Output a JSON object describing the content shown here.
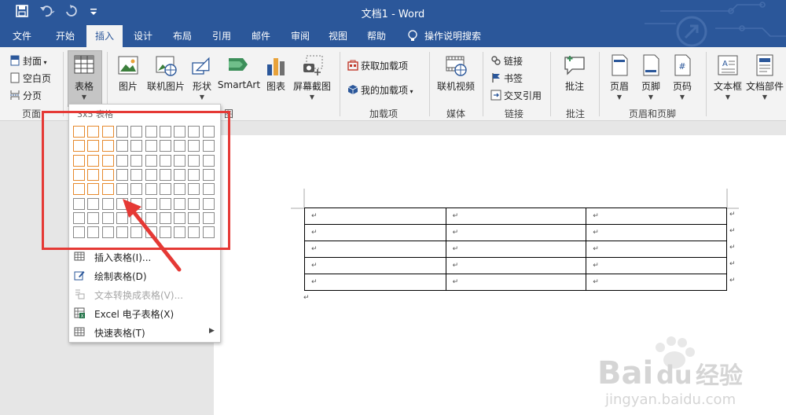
{
  "titlebar": {
    "title": "文档1 - Word",
    "icons": [
      "save-icon",
      "undo-icon",
      "redo-icon",
      "customize-icon"
    ]
  },
  "tabs": [
    {
      "label": "文件"
    },
    {
      "label": "开始"
    },
    {
      "label": "插入",
      "active": true
    },
    {
      "label": "设计"
    },
    {
      "label": "布局"
    },
    {
      "label": "引用"
    },
    {
      "label": "邮件"
    },
    {
      "label": "审阅"
    },
    {
      "label": "视图"
    },
    {
      "label": "帮助"
    },
    {
      "label": "操作说明搜索"
    }
  ],
  "ribbon": {
    "pages": {
      "cover": "封面",
      "blank": "空白页",
      "break": "分页",
      "group": "页面"
    },
    "table_button": "表格",
    "illustrations": {
      "picture": "图片",
      "online_picture": "联机图片",
      "shapes": "形状",
      "smartart": "SmartArt",
      "chart": "图表",
      "screenshot": "屏幕截图",
      "group_tail": "图"
    },
    "addins": {
      "get": "获取加载项",
      "mine": "我的加载项",
      "group": "加载项"
    },
    "media": {
      "online_video": "联机视频",
      "group": "媒体"
    },
    "links": {
      "link": "链接",
      "bookmark": "书签",
      "cross_ref": "交叉引用",
      "group": "链接"
    },
    "comments": {
      "comment": "批注",
      "group": "批注"
    },
    "header_footer": {
      "header": "页眉",
      "footer": "页脚",
      "page_number": "页码",
      "group": "页眉和页脚"
    },
    "text": {
      "textbox": "文本框",
      "doc_parts": "文档部件"
    }
  },
  "dropdown": {
    "grid_header": "3x5 表格",
    "selected_cols": 3,
    "selected_rows": 5,
    "menu": [
      {
        "label": "插入表格(I)...",
        "icon": "table-insert-icon",
        "disabled": false
      },
      {
        "label": "绘制表格(D)",
        "icon": "pencil-icon",
        "disabled": false
      },
      {
        "label": "文本转换成表格(V)...",
        "icon": "convert-text-icon",
        "disabled": true
      },
      {
        "label": "Excel 电子表格(X)",
        "icon": "excel-icon",
        "disabled": false
      },
      {
        "label": "快速表格(T)",
        "icon": "quick-table-icon",
        "disabled": false,
        "submenu": true
      }
    ]
  },
  "document": {
    "para_mark": "↵",
    "table_rows": 5,
    "table_cols": 3
  },
  "watermark": {
    "brand": "Bai",
    "brand2": "du",
    "suffix": "经验",
    "url": "jingyan.baidu.com"
  },
  "colors": {
    "word_blue": "#2b579a",
    "selection_orange": "#e68a2e",
    "highlight_red": "#e53935",
    "ribbon_bg": "#f3f3f3"
  }
}
